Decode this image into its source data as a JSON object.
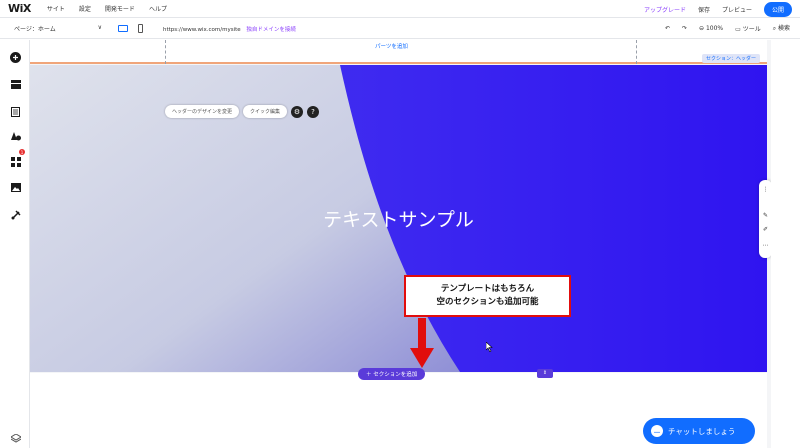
{
  "topbar": {
    "logo": "WiX",
    "menu": [
      "サイト",
      "設定",
      "開発モード",
      "ヘルプ"
    ],
    "upgrade": "アップグレード",
    "save": "保存",
    "preview": "プレビュー",
    "publish": "公開"
  },
  "toolbar": {
    "page_label": "ページ：ホーム",
    "page_chevron": "∨",
    "url": "https://www.wix.com/mysite",
    "connect_domain": "独自ドメインを接続",
    "zoom": "100%",
    "tools": "ツール",
    "search": "検索",
    "undo": "↶",
    "redo": "↷"
  },
  "canvas": {
    "add_parts": "パーツを追加",
    "section_tag": "セクション：ヘッダー",
    "hero_title": "テキストサンプル",
    "header_design_btn": "ヘッダーのデザインを変更",
    "quick_edit_btn": "クイック編集",
    "add_section": "＋ セクションを追加",
    "section_handle": "⇕"
  },
  "callout": {
    "line1": "テンプレートはもちろん",
    "line2": "空のセクションも追加可能"
  },
  "sidebar": {
    "badge": "1"
  },
  "chat": {
    "label": "チャットしましょう",
    "bubble": "…"
  },
  "colors": {
    "accent": "#116dff",
    "hero": "#3a1ff0",
    "callout_border": "#e10d0d",
    "upgrade": "#8a3ffc"
  }
}
